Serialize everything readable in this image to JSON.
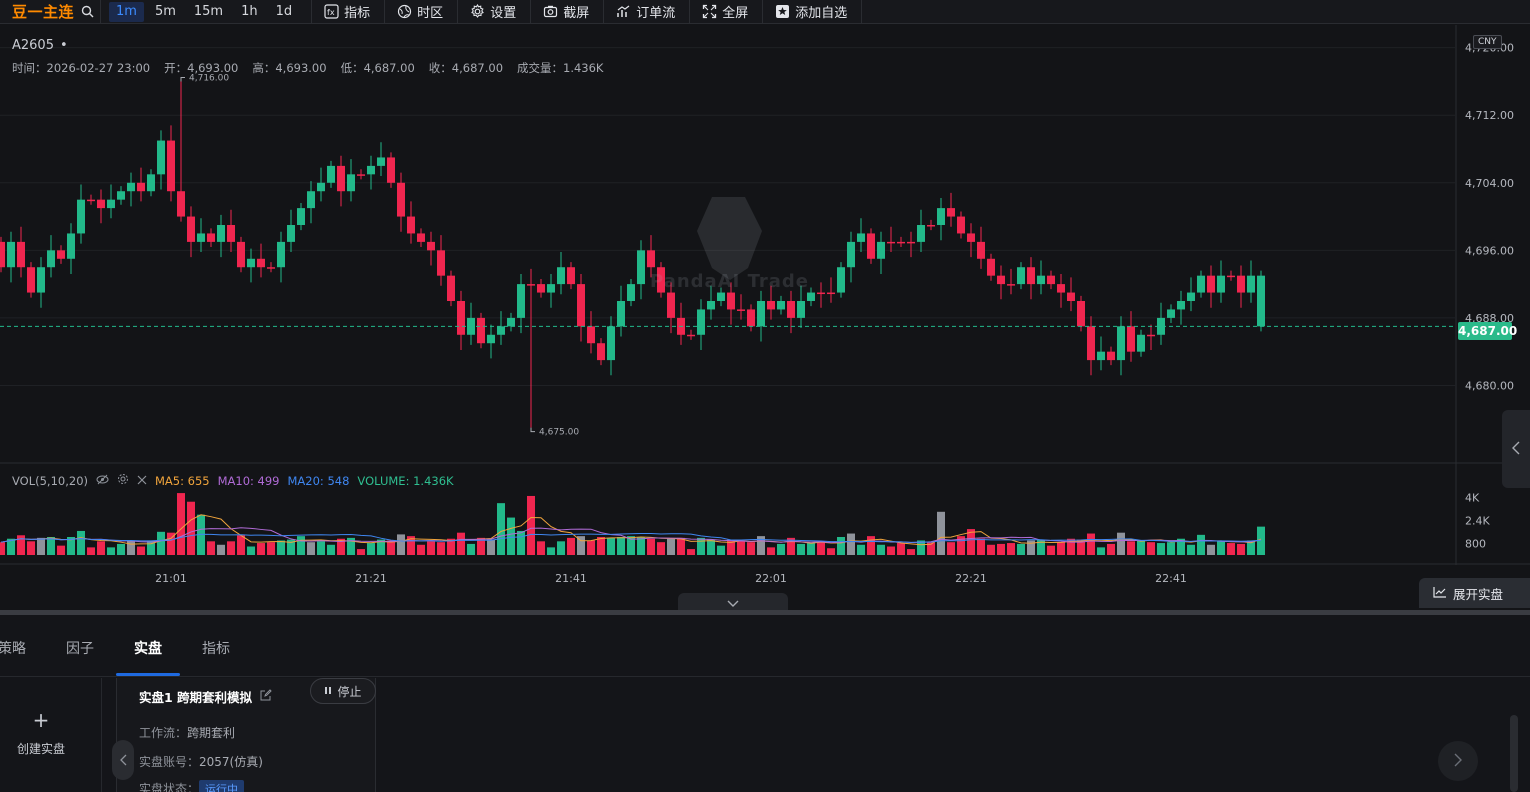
{
  "toolbar": {
    "symbol_title": "豆一主连",
    "intervals": [
      "1m",
      "5m",
      "15m",
      "1h",
      "1d"
    ],
    "active_interval": "1m",
    "buttons": {
      "indicators": "指标",
      "timezone": "时区",
      "settings": "设置",
      "screenshot": "截屏",
      "orderflow": "订单流",
      "fullscreen": "全屏",
      "add_watchlist": "添加自选"
    }
  },
  "chart_header": {
    "symbol": "A2605",
    "dot": "•",
    "time": "时间：2026-02-27 23:00",
    "open": "开：4,693.00",
    "high": "高：4,693.00",
    "low": "低：4,687.00",
    "close": "收：4,687.00",
    "volume": "成交量：1.436K",
    "currency": "CNY"
  },
  "volume_legend": {
    "title": "VOL(5,10,20)",
    "ma5": "MA5: 655",
    "ma10": "MA10: 499",
    "ma20": "MA20: 548",
    "volume": "VOLUME: 1.436K"
  },
  "watermark": "PandaAI Trade",
  "last_price": "4,687.00",
  "expand_live_label": "展开实盘",
  "colors": {
    "up": "#f0264f",
    "down": "#22b98a",
    "accent": "#1f6ae0",
    "ma5": "#f0a43c",
    "ma10": "#b06bd6",
    "ma20": "#3f86f0",
    "symbol": "#ff8a00"
  },
  "chart_data": {
    "type": "candlestick",
    "price_axis": {
      "ticks": [
        "4,720.00",
        "4,712.00",
        "4,704.00",
        "4,696.00",
        "4,688.00",
        "4,680.00"
      ],
      "values": [
        4720,
        4712,
        4704,
        4696,
        4688,
        4680
      ],
      "ylim": [
        4672,
        4721.5
      ]
    },
    "volume_axis": {
      "ticks": [
        "4K",
        "2.4K",
        "800"
      ],
      "values": [
        4000,
        2400,
        800
      ]
    },
    "time_ticks": [
      "21:01",
      "21:21",
      "21:41",
      "22:01",
      "22:21",
      "22:41"
    ],
    "time_tick_index": [
      17,
      37,
      57,
      77,
      97,
      117
    ],
    "high_label": "4,716.00",
    "low_label": "4,675.00",
    "close_series": [
      4697,
      4694,
      4697,
      4694,
      4691,
      4694,
      4696,
      4695,
      4698,
      4702,
      4702,
      4701,
      4702,
      4703,
      4704,
      4703,
      4705,
      4709,
      4703,
      4700,
      4697,
      4698,
      4697,
      4699,
      4697,
      4694,
      4695,
      4694,
      4694,
      4697,
      4699,
      4701,
      4703,
      4704,
      4706,
      4703,
      4705,
      4705,
      4706,
      4707,
      4704,
      4700,
      4698,
      4697,
      4696,
      4693,
      4690,
      4686,
      4688,
      4685,
      4686,
      4687,
      4688,
      4692,
      4692,
      4691,
      4692,
      4694,
      4692,
      4687,
      4685,
      4683,
      4687,
      4690,
      4692,
      4696,
      4694,
      4691,
      4688,
      4686,
      4686,
      4689,
      4690,
      4691,
      4689,
      4689,
      4687,
      4690,
      4689,
      4690,
      4688,
      4690,
      4691,
      4691,
      4691,
      4694,
      4697,
      4698,
      4695,
      4697,
      4697,
      4697,
      4697,
      4699,
      4699,
      4701,
      4700,
      4698,
      4697,
      4695,
      4693,
      4692,
      4692,
      4694,
      4692,
      4693,
      4692,
      4691,
      4690,
      4687,
      4683,
      4684,
      4683,
      4687,
      4684,
      4686,
      4686,
      4688,
      4689,
      4690,
      4691,
      4693,
      4691,
      4693,
      4693,
      4691,
      4687
    ],
    "open_series": [
      4694,
      4697,
      4694,
      4691,
      4694,
      4696,
      4695,
      4698,
      4702,
      4702,
      4701,
      4702,
      4703,
      4704,
      4703,
      4705,
      4709,
      4703,
      4700,
      4697,
      4698,
      4697,
      4699,
      4697,
      4694,
      4695,
      4694,
      4694,
      4697,
      4699,
      4701,
      4703,
      4704,
      4706,
      4703,
      4705,
      4705,
      4706,
      4707,
      4704,
      4700,
      4698,
      4697,
      4696,
      4693,
      4690,
      4686,
      4688,
      4685,
      4686,
      4687,
      4688,
      4692,
      4692,
      4691,
      4692,
      4694,
      4692,
      4687,
      4685,
      4683,
      4687,
      4690,
      4692,
      4696,
      4694,
      4691,
      4688,
      4686,
      4686,
      4689,
      4690,
      4691,
      4689,
      4689,
      4687,
      4690,
      4689,
      4690,
      4688,
      4690,
      4691,
      4691,
      4691,
      4694,
      4697,
      4698,
      4695,
      4697,
      4697,
      4697,
      4697,
      4699,
      4699,
      4701,
      4700,
      4698,
      4697,
      4695,
      4693,
      4692,
      4692,
      4694,
      4692,
      4693,
      4692,
      4691,
      4690,
      4687,
      4683,
      4684,
      4683,
      4687,
      4684,
      4686,
      4686,
      4688,
      4689,
      4690,
      4691,
      4693,
      4691,
      4693,
      4693,
      4691,
      4693,
      4693
    ],
    "volume_note": "relative volumes per bar"
  },
  "bottom_panel": {
    "tabs": [
      "策略",
      "因子",
      "实盘",
      "指标"
    ],
    "active_tab": "实盘",
    "create_label": "创建实盘",
    "create_plus": "+",
    "card": {
      "title": "实盘1 跨期套利模拟",
      "stop_label": "停止",
      "workflow_label": "工作流：",
      "workflow_value": "跨期套利",
      "account_label": "实盘账号：",
      "account_value": "2057(仿真)",
      "status_label": "实盘状态：",
      "status_value": "运行中"
    }
  }
}
